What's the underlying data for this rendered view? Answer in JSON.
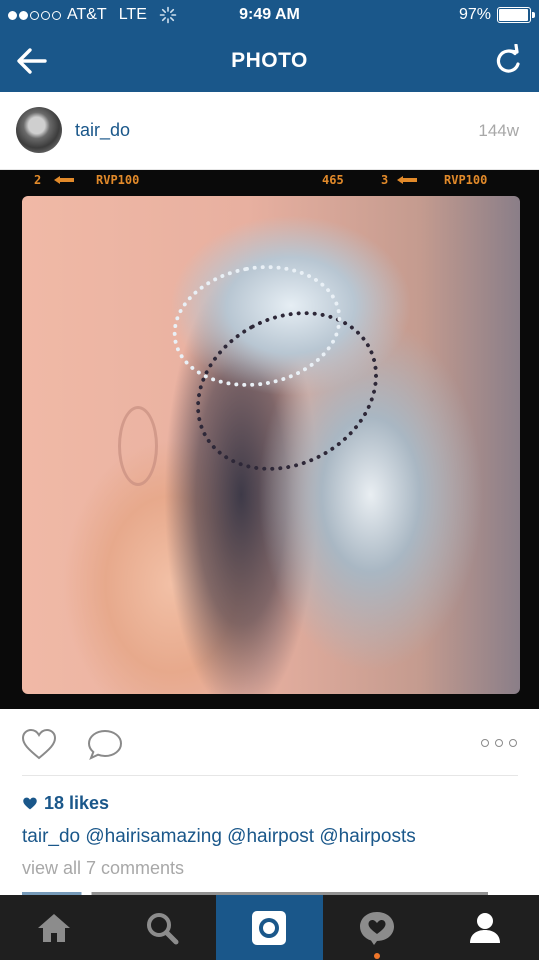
{
  "status_bar": {
    "carrier": "AT&T",
    "network": "LTE",
    "signal_bars": 2,
    "time": "9:49 AM",
    "battery_percent": "97%",
    "battery_level": 0.97
  },
  "nav": {
    "title": "PHOTO",
    "back_icon": "arrow-left-icon",
    "refresh_icon": "refresh-icon"
  },
  "post": {
    "username": "tair_do",
    "age": "144w",
    "filmstrip": {
      "frame_a": "2",
      "code_a": "RVP100",
      "frame_number": "465",
      "frame_b": "3",
      "code_b": "RVP100"
    },
    "likes": "18 likes",
    "caption": {
      "author": "tair_do",
      "text": "@hairisamazing @hairpost @hairposts"
    },
    "view_comments": "view all 7 comments"
  },
  "tabbar": {
    "items": [
      {
        "icon": "home-icon"
      },
      {
        "icon": "search-icon"
      },
      {
        "icon": "camera-icon"
      },
      {
        "icon": "activity-icon"
      },
      {
        "icon": "profile-icon"
      }
    ],
    "active_index": 2
  },
  "colors": {
    "brand": "#1a578a",
    "tabbar_bg": "#1f1f1f",
    "muted": "#a8a8a8",
    "notification_dot": "#f0762a"
  }
}
